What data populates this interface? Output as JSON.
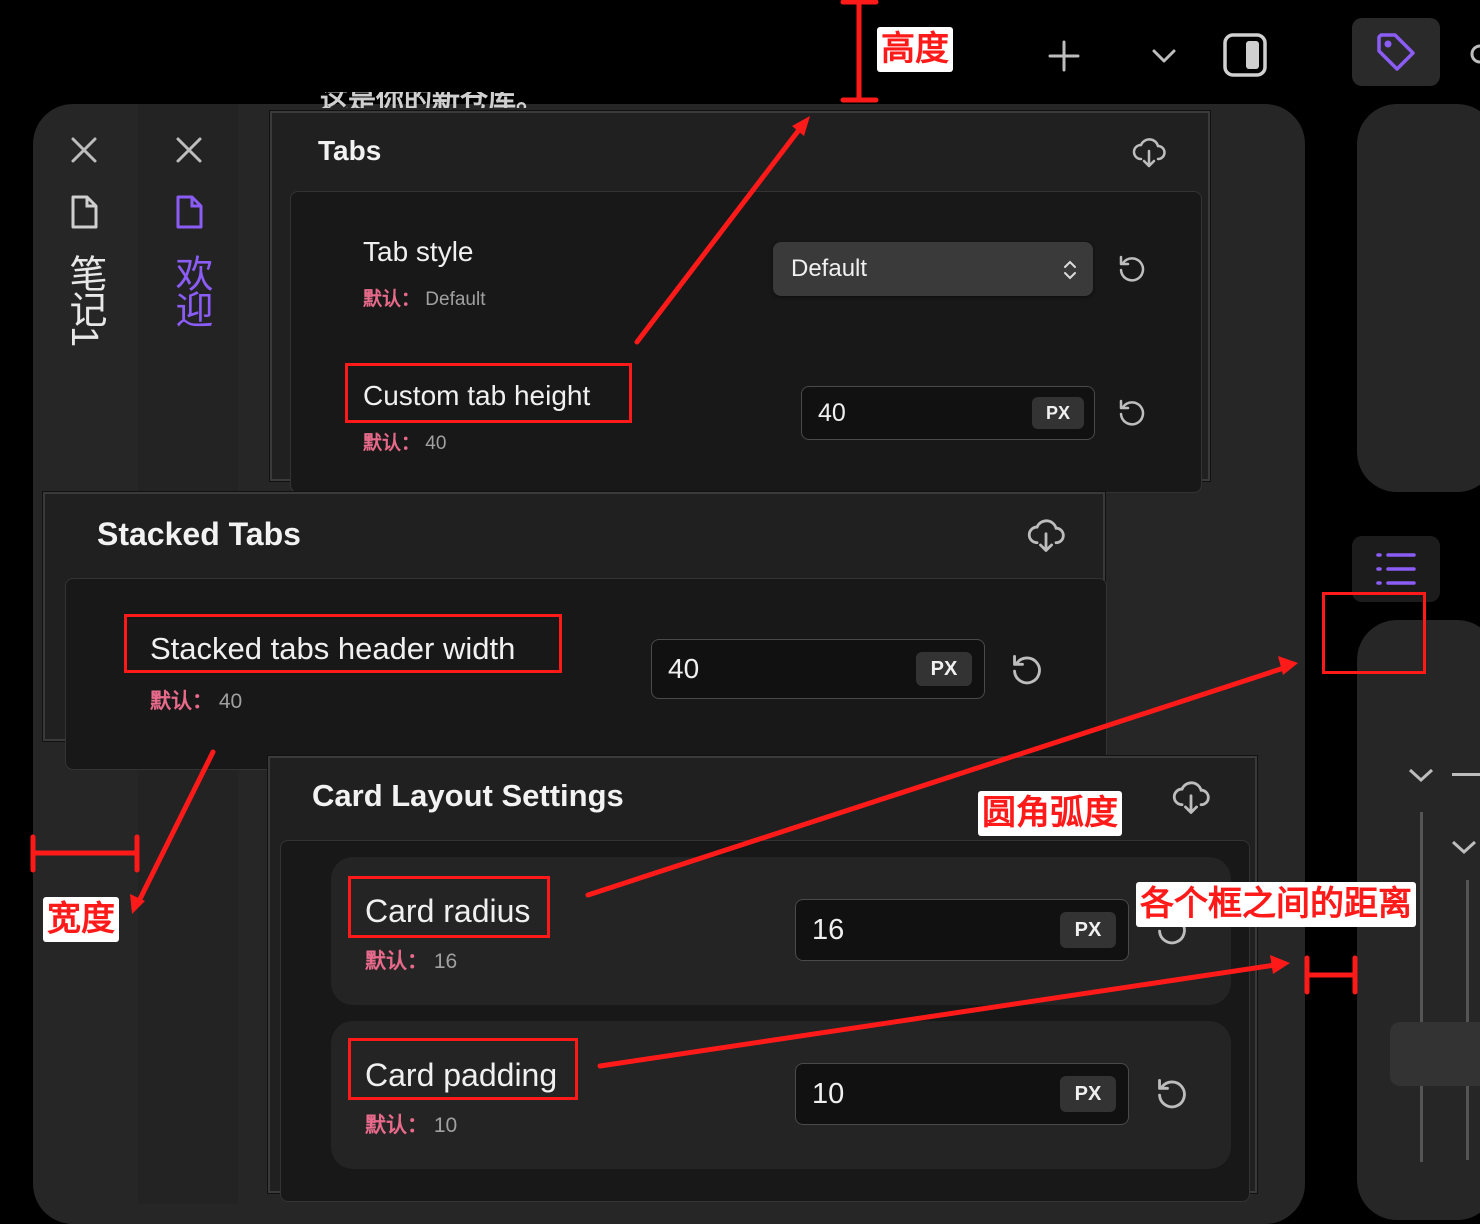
{
  "top_bar": {
    "add_icon": "plus-icon",
    "dropdown_icon": "chevron-down-icon",
    "sidebar_icon": "sidebar-toggle-icon",
    "tag_icon": "tag-icon",
    "accent": "#8b5cf6"
  },
  "stacked_tabs": [
    {
      "title": "笔记1",
      "icon": "file-icon",
      "close": "close-icon"
    },
    {
      "title": "欢迎",
      "icon": "file-icon",
      "close": "close-icon",
      "active": true
    }
  ],
  "right_panel": {
    "list_icon": "list-icon"
  },
  "settings": {
    "tabs": {
      "title": "Tabs",
      "tab_style": {
        "name": "Tab style",
        "default_label": "默认：",
        "default_value": "Default",
        "value": "Default"
      },
      "custom_tab_height": {
        "name": "Custom tab height",
        "default_label": "默认：",
        "default_value": "40",
        "value": "40",
        "unit": "PX"
      }
    },
    "stacked_tabs": {
      "title": "Stacked Tabs",
      "header_width": {
        "name": "Stacked tabs header width",
        "default_label": "默认：",
        "default_value": "40",
        "value": "40",
        "unit": "PX"
      }
    },
    "card_layout": {
      "title": "Card Layout Settings",
      "card_radius": {
        "name": "Card radius",
        "default_label": "默认：",
        "default_value": "16",
        "value": "16",
        "unit": "PX"
      },
      "card_padding": {
        "name": "Card padding",
        "default_label": "默认：",
        "default_value": "10",
        "value": "10",
        "unit": "PX"
      }
    }
  },
  "annotations": {
    "height": "高度",
    "width": "宽度",
    "radius": "圆角弧度",
    "gap": "各个框之间的距离",
    "color": "#ff1a1a"
  }
}
